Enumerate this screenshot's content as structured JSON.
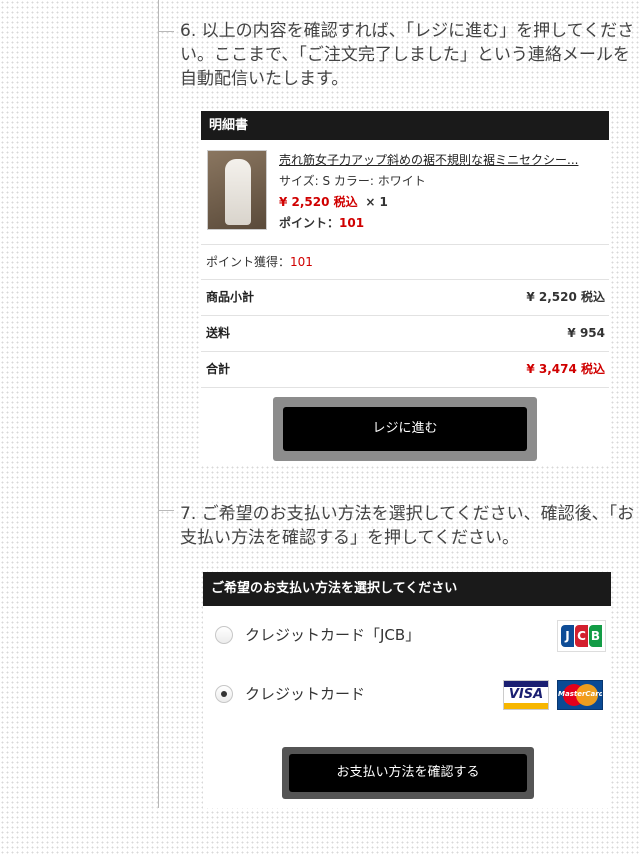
{
  "steps": {
    "step6": {
      "number": "6.",
      "text": "以上の内容を確認すれば、「レジに進む」を押してください。ここまで、「ご注文完了しました」という連絡メールを自動配信いたします。"
    },
    "step7": {
      "number": "7.",
      "text": "ご希望のお支払い方法を選択してください、確認後、「お支払い方法を確認する」を押してください。"
    }
  },
  "invoice": {
    "header": "明細書",
    "product": {
      "name": "売れ筋女子力アップ斜めの裾不規則な裾ミニセクシー...",
      "size_color": "サイズ: S カラー: ホワイト",
      "price": "¥ 2,520 税込",
      "quantity": "× 1",
      "points_label": "ポイント：",
      "points_value": "101",
      "thumbnail_icon": "dress-product-photo"
    },
    "points_earned_label": "ポイント獲得：",
    "points_earned_value": "101",
    "subtotal_label": "商品小計",
    "subtotal_value": "¥ 2,520 税込",
    "shipping_label": "送料",
    "shipping_value": "¥ 954",
    "total_label": "合計",
    "total_value": "¥ 3,474 税込",
    "checkout_button": "レジに進む"
  },
  "payment": {
    "header": "ご希望のお支払い方法を選択してください",
    "options": [
      {
        "label": "クレジットカード「JCB」",
        "selected": false,
        "logos": [
          "jcb-logo"
        ]
      },
      {
        "label": "クレジットカード",
        "selected": true,
        "logos": [
          "visa-logo",
          "mastercard-logo"
        ]
      }
    ],
    "confirm_button": "お支払い方法を確認する",
    "logo_text": {
      "jcb": [
        "J",
        "C",
        "B"
      ],
      "visa": "VISA",
      "mastercard": "MasterCard"
    }
  },
  "colors": {
    "accent_red": "#d00000",
    "header_bg": "#1a1a1a",
    "button_bg": "#000000",
    "button_border": "#8c8c8c",
    "jcb_blue": "#0e4c96",
    "jcb_red": "#d3202e",
    "jcb_green": "#139c46"
  }
}
